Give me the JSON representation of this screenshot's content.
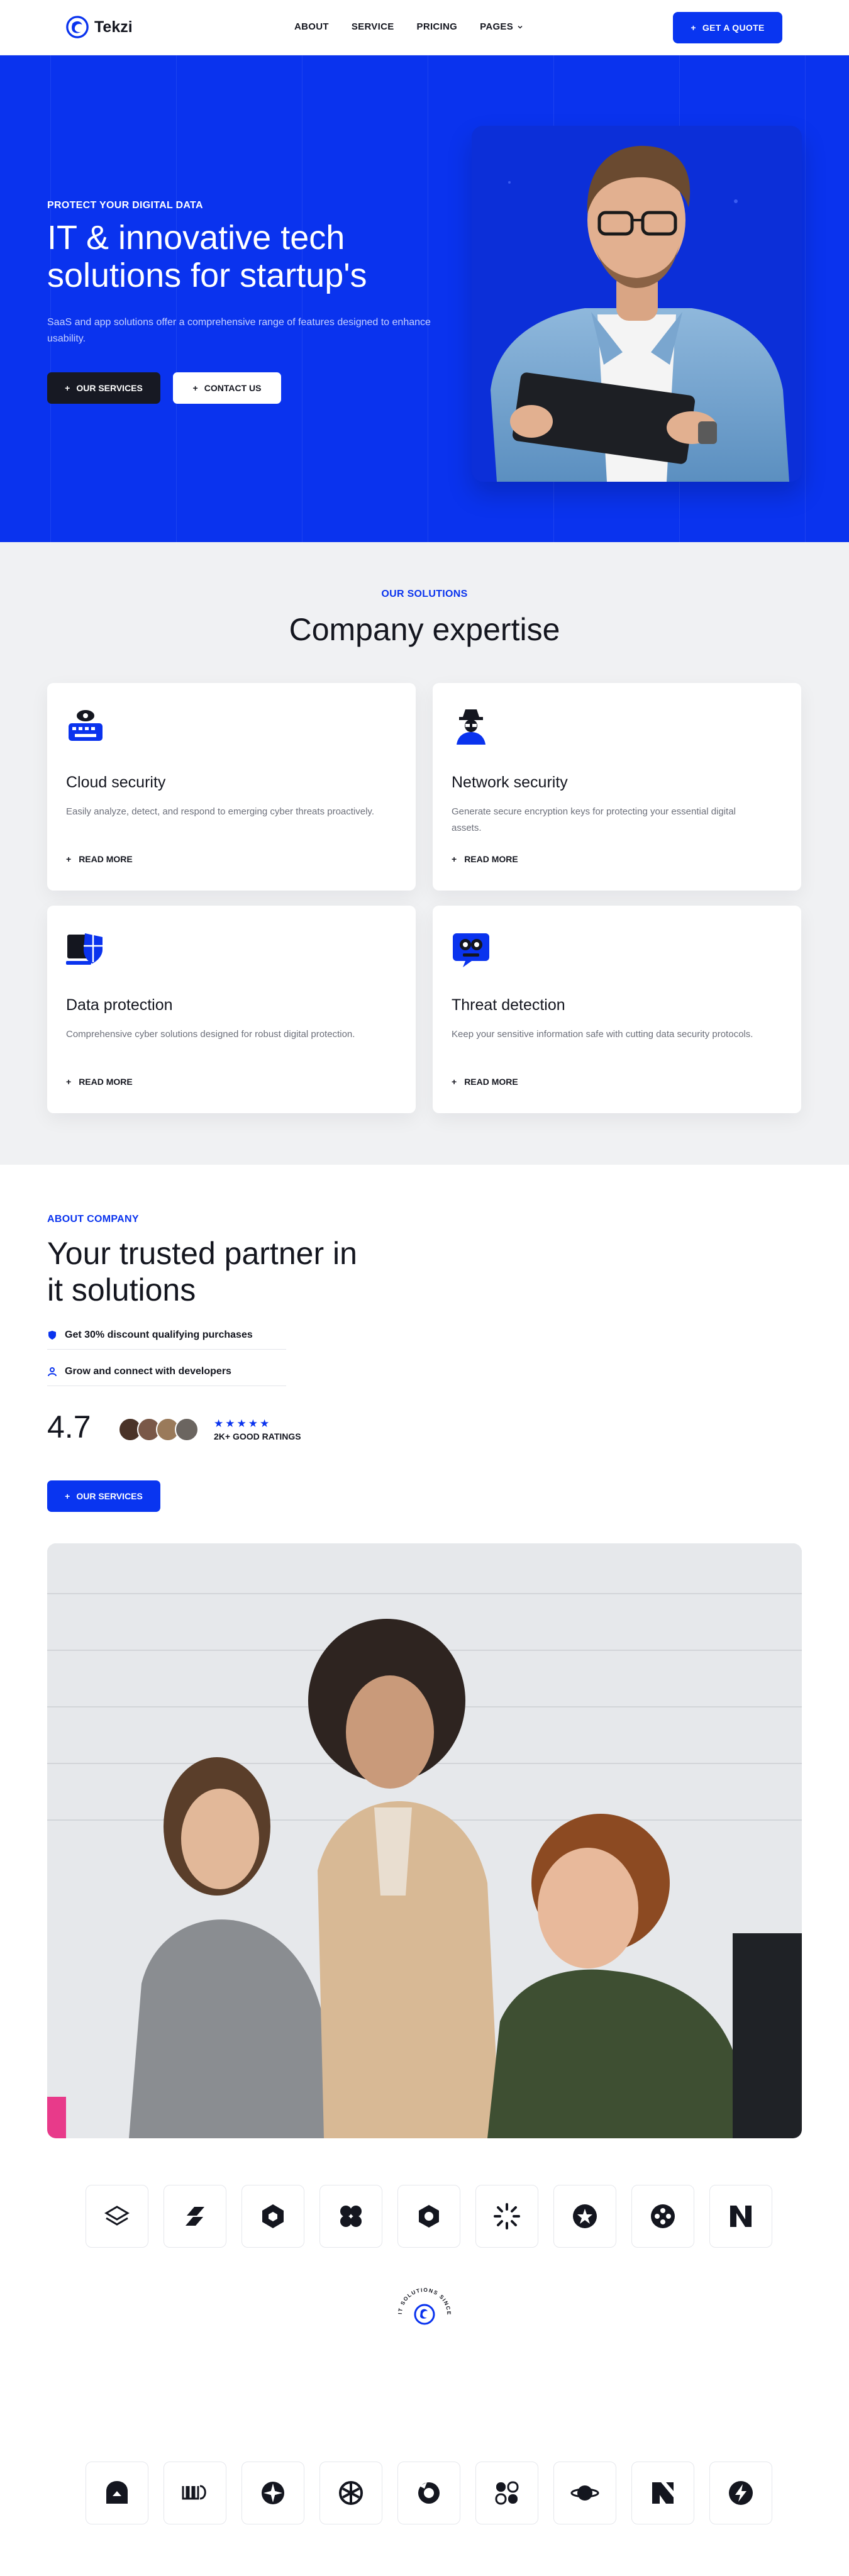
{
  "brand": {
    "name": "Tekzi",
    "accent": "#0a33ee",
    "dark": "#171923"
  },
  "nav": {
    "items": [
      {
        "label": "ABOUT"
      },
      {
        "label": "SERVICE"
      },
      {
        "label": "PRICING"
      },
      {
        "label": "PAGES"
      }
    ],
    "cta": "GET A QUOTE"
  },
  "hero": {
    "eyebrow": "PROTECT YOUR DIGITAL DATA",
    "title": "IT & innovative tech solutions for startup's",
    "subtitle": "SaaS and app solutions offer a comprehensive range of features designed to enhance usability.",
    "btn_services": "OUR SERVICES",
    "btn_contact": "CONTACT US"
  },
  "solutions": {
    "eyebrow": "OUR SOLUTIONS",
    "title": "Company expertise",
    "cards": [
      {
        "title": "Cloud security",
        "desc": "Easily analyze, detect, and respond to emerging cyber threats proactively.",
        "more": "READ MORE",
        "icon": "cloud-security-icon"
      },
      {
        "title": "Network security",
        "desc": "Generate secure encryption keys for protecting your essential digital assets.",
        "more": "READ MORE",
        "icon": "network-security-icon"
      },
      {
        "title": "Data protection",
        "desc": "Comprehensive cyber solutions designed for robust digital protection.",
        "more": "READ MORE",
        "icon": "data-protection-icon"
      },
      {
        "title": "Threat detection",
        "desc": "Keep your sensitive information safe with cutting data security protocols.",
        "more": "READ MORE",
        "icon": "threat-detection-icon"
      }
    ]
  },
  "about": {
    "eyebrow": "ABOUT COMPANY",
    "title": "Your trusted partner in it solutions",
    "items": [
      {
        "label": "Get 30% discount qualifying purchases",
        "icon": "shield-icon"
      },
      {
        "label": "Grow and connect with developers",
        "icon": "person-icon"
      }
    ],
    "rating": "4.7",
    "stars": "★★★★★",
    "rating_text": "2K+ GOOD RATINGS",
    "btn": "OUR SERVICES"
  },
  "brands": {
    "row1": [
      "stack-logo-icon",
      "bolt-shape-logo-icon",
      "hexagon-logo-icon",
      "clover-logo-icon",
      "hex-ring-logo-icon",
      "sunburst-logo-icon",
      "star-circle-logo-icon",
      "quad-dot-logo-icon",
      "n-mark-logo-icon"
    ],
    "row2": [
      "arch-logo-icon",
      "wave-letters-logo-icon",
      "compass-logo-icon",
      "knot-logo-icon",
      "ring-logo-icon",
      "flower-logo-icon",
      "saturn-logo-icon",
      "angular-n-logo-icon",
      "bolt-circle-logo-icon"
    ],
    "badge_text": "IT SOLUTIONS SINCE"
  }
}
